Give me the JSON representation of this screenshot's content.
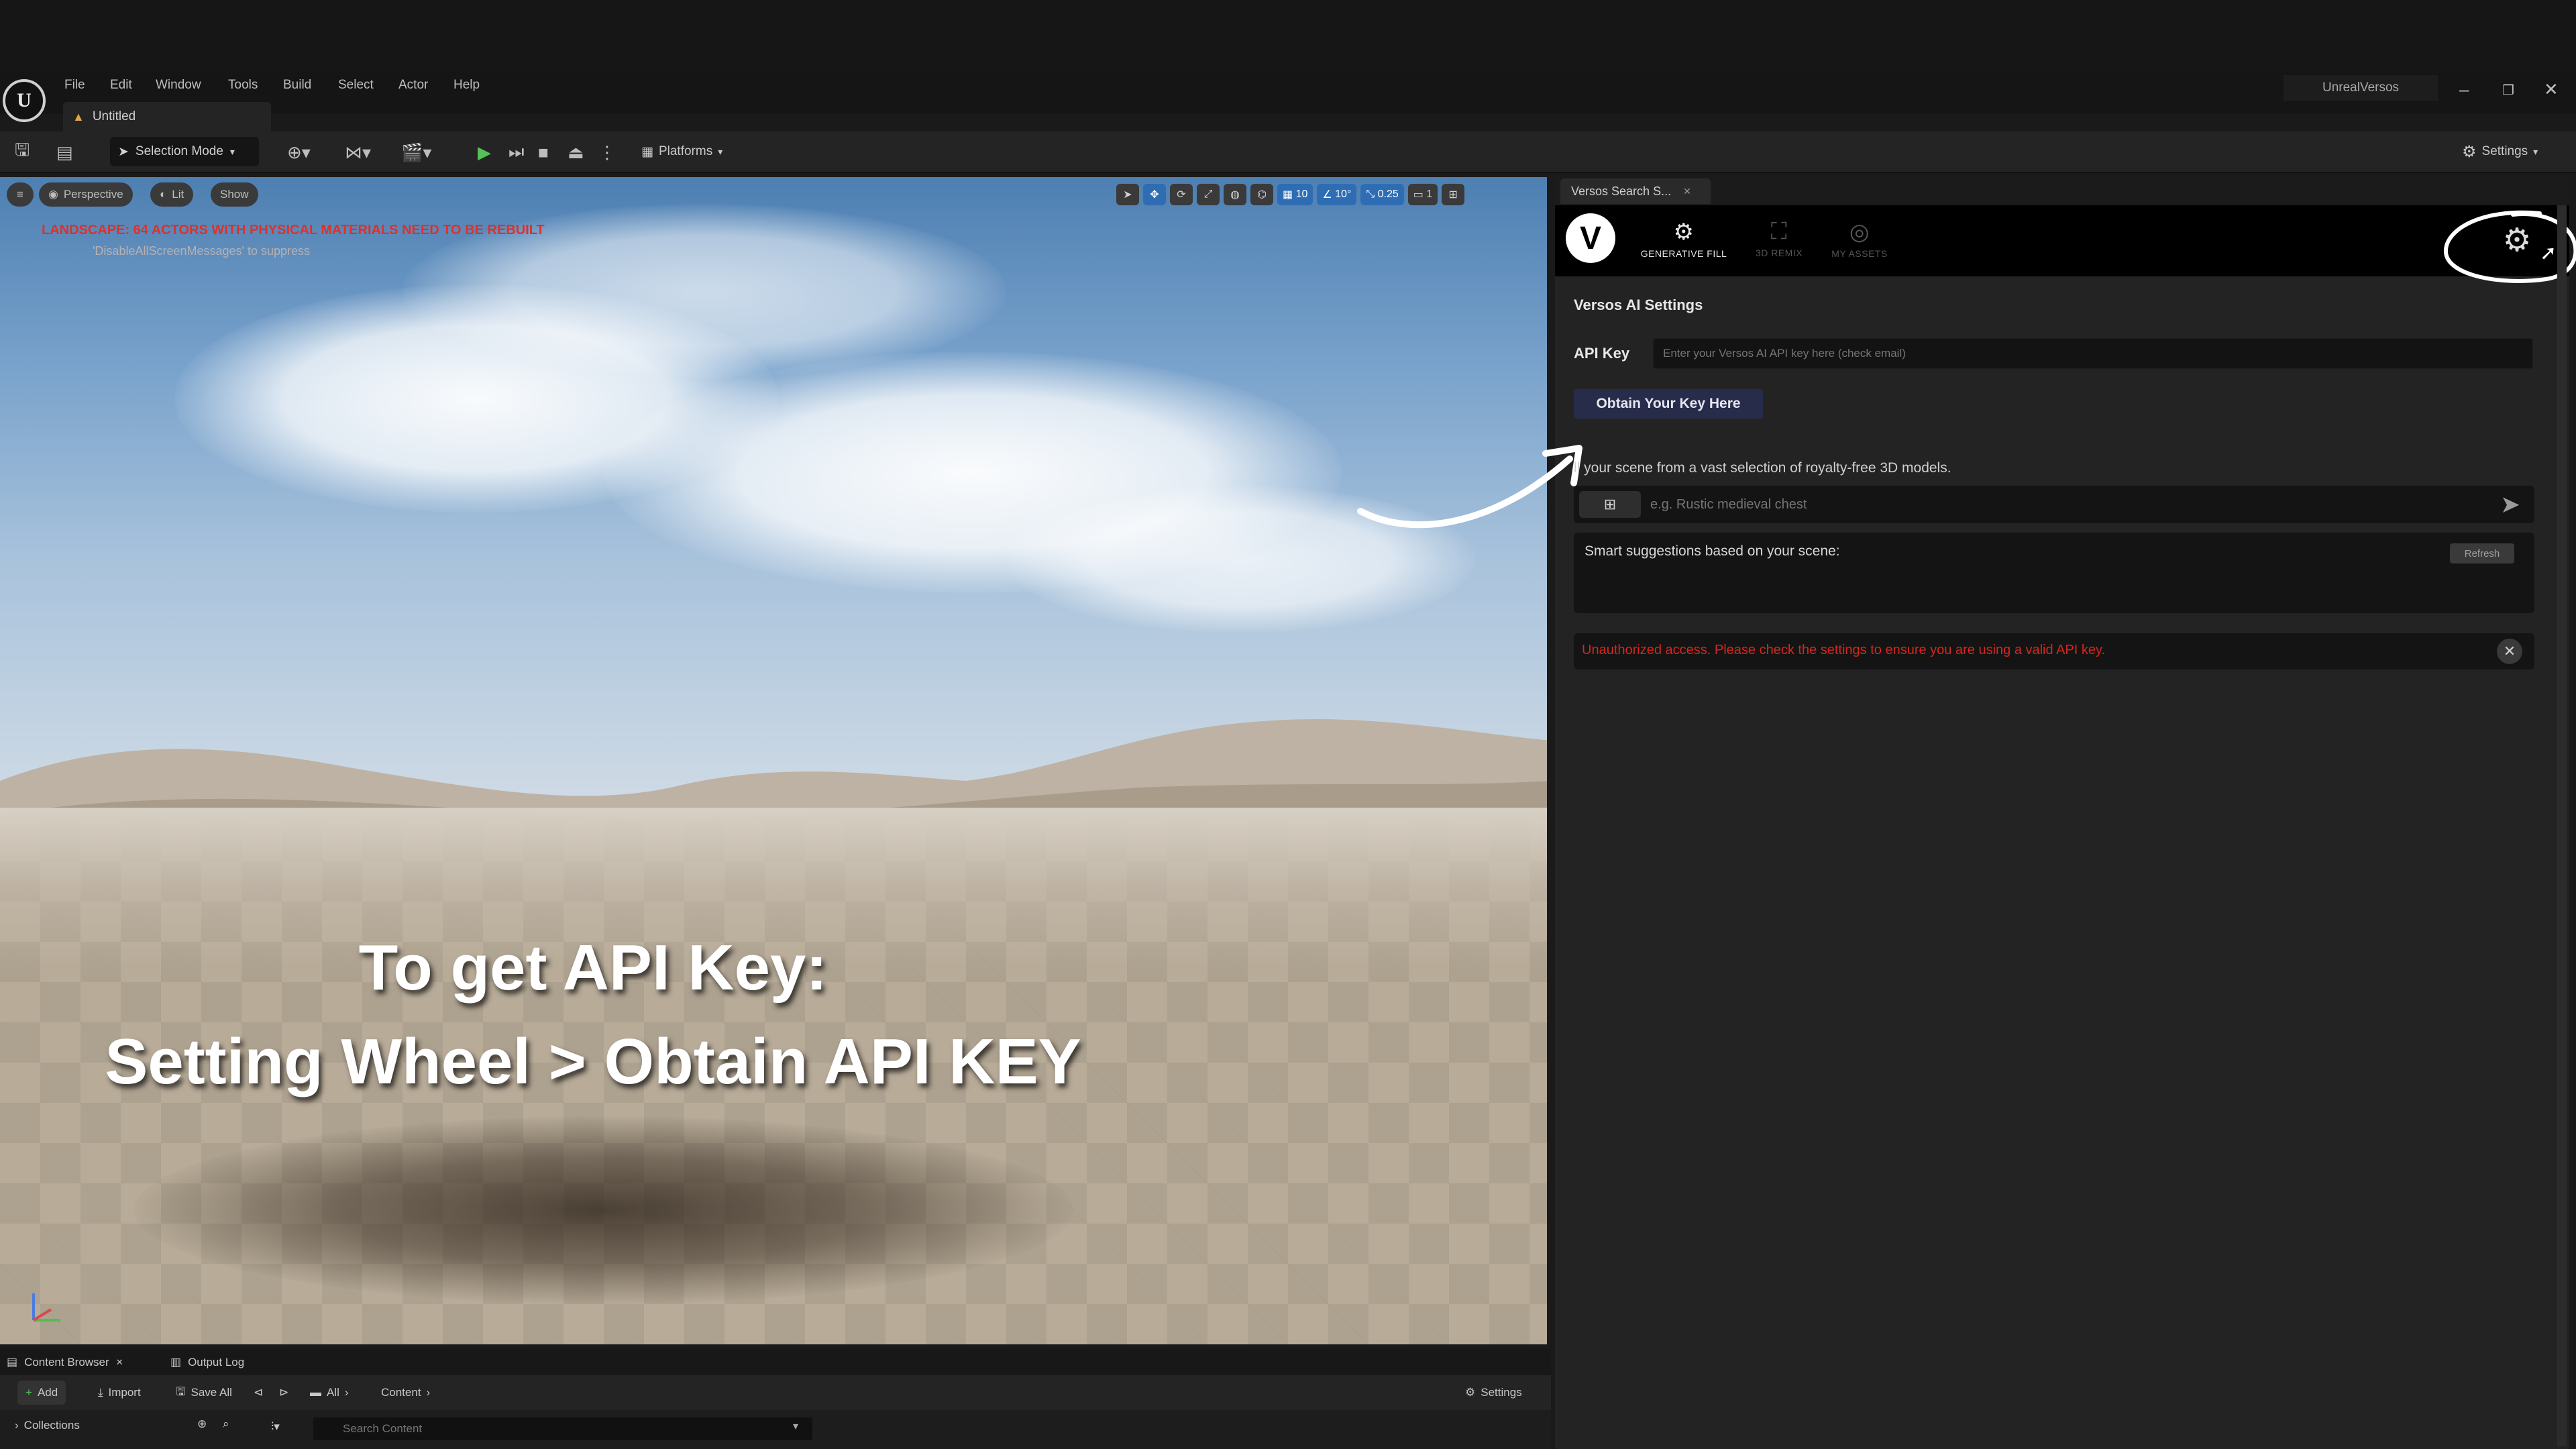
{
  "menu": {
    "items": [
      "File",
      "Edit",
      "Window",
      "Tools",
      "Build",
      "Select",
      "Actor",
      "Help"
    ],
    "project_name": "UnrealVersos",
    "level_tab": "Untitled"
  },
  "toolbar": {
    "selection_mode": "Selection Mode",
    "platforms": "Platforms",
    "settings": "Settings"
  },
  "viewport": {
    "perspective": "Perspective",
    "lit": "Lit",
    "show": "Show",
    "grid_snap": "10",
    "rotate_snap": "10°",
    "scale_snap": "0.25",
    "camera_speed": "1",
    "warning": "LANDSCAPE: 64 ACTORS WITH PHYSICAL MATERIALS NEED TO BE REBUILT",
    "warning_sub": "'DisableAllScreenMessages' to suppress"
  },
  "overlay": {
    "line1": "To get API Key:",
    "line2": "Setting Wheel > Obtain API KEY"
  },
  "panel": {
    "tab_label": "Versos Search S...",
    "tabs": {
      "generative_fill": "GENERATIVE FILL",
      "remix": "3D REMIX",
      "my_assets": "MY ASSETS"
    },
    "settings_title": "Versos AI Settings",
    "api_label": "API Key",
    "api_placeholder": "Enter your Versos AI API key here (check email)",
    "obtain_button": "Obtain Your Key Here",
    "fill_description": "ll your scene from a vast selection of royalty-free 3D models.",
    "prompt_placeholder": "e.g. Rustic medieval chest",
    "suggestions_label": "Smart suggestions based on your scene:",
    "refresh": "Refresh",
    "error": "Unauthorized access. Please check the settings to ensure you are using a valid API key."
  },
  "content_browser": {
    "tab": "Content Browser",
    "output_log": "Output Log",
    "add": "Add",
    "import": "Import",
    "save_all": "Save All",
    "path_all": "All",
    "path_content": "Content",
    "settings": "Settings",
    "collections": "Collections",
    "search_placeholder": "Search Content"
  },
  "colors": {
    "warning_red": "#e0302a",
    "error_red": "#d7261f",
    "obtain_button_bg": "#262c4a",
    "play_green": "#57c157",
    "snap_blue": "#2e6db3"
  }
}
